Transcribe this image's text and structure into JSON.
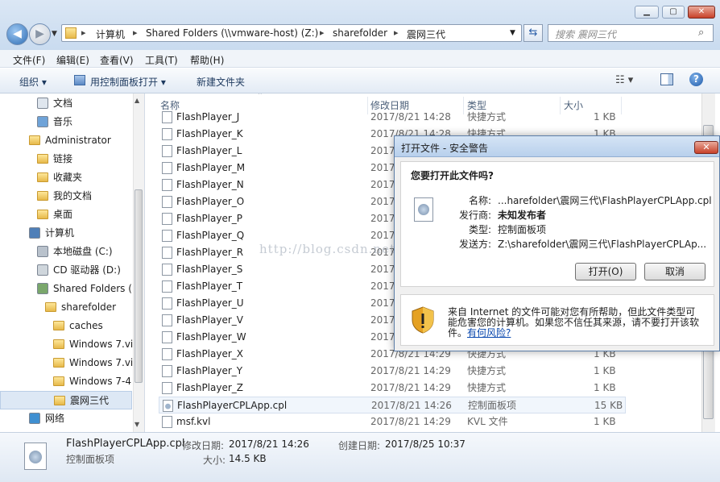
{
  "window": {
    "minimize": "▁",
    "maximize": "▢",
    "close": "✕"
  },
  "address": {
    "crumbs": [
      "计算机",
      "Shared Folders (\\\\vmware-host) (Z:)",
      "sharefolder",
      "震网三代"
    ],
    "search_placeholder": "搜索 震网三代"
  },
  "menubar": [
    "文件(F)",
    "编辑(E)",
    "查看(V)",
    "工具(T)",
    "帮助(H)"
  ],
  "toolbar": {
    "organize": "组织 ▾",
    "open_cpl": "用控制面板打开 ▾",
    "new_folder": "新建文件夹"
  },
  "sidebar": {
    "items": [
      {
        "label": "文档",
        "icon": "document-library-icon"
      },
      {
        "label": "音乐",
        "icon": "music-icon"
      },
      {
        "label": "Administrator",
        "icon": "user-folder-icon"
      },
      {
        "label": "链接",
        "icon": "folder-icon"
      },
      {
        "label": "收藏夹",
        "icon": "folder-icon"
      },
      {
        "label": "我的文档",
        "icon": "folder-icon"
      },
      {
        "label": "桌面",
        "icon": "folder-icon"
      },
      {
        "label": "计算机",
        "icon": "computer-icon"
      },
      {
        "label": "本地磁盘 (C:)",
        "icon": "drive-icon"
      },
      {
        "label": "CD 驱动器 (D:)",
        "icon": "cd-icon"
      },
      {
        "label": "Shared Folders (",
        "icon": "network-drive-icon"
      },
      {
        "label": "sharefolder",
        "icon": "folder-icon"
      },
      {
        "label": "caches",
        "icon": "folder-icon"
      },
      {
        "label": "Windows 7.vi",
        "icon": "folder-icon"
      },
      {
        "label": "Windows 7.vi",
        "icon": "folder-icon"
      },
      {
        "label": "Windows 7-4",
        "icon": "folder-icon"
      },
      {
        "label": "震网三代",
        "icon": "folder-icon"
      },
      {
        "label": "网络",
        "icon": "network-icon"
      }
    ]
  },
  "columns": {
    "name": "名称",
    "modified": "修改日期",
    "type": "类型",
    "size": "大小"
  },
  "files": [
    {
      "name": "FlashPlayer_J",
      "date": "2017/8/21 14:28",
      "type": "快捷方式",
      "size": "1 KB"
    },
    {
      "name": "FlashPlayer_K",
      "date": "2017/8/21 14:28",
      "type": "快捷方式",
      "size": "1 KB"
    },
    {
      "name": "FlashPlayer_L",
      "date": "2017",
      "type": "",
      "size": ""
    },
    {
      "name": "FlashPlayer_M",
      "date": "2017",
      "type": "",
      "size": ""
    },
    {
      "name": "FlashPlayer_N",
      "date": "2017",
      "type": "",
      "size": ""
    },
    {
      "name": "FlashPlayer_O",
      "date": "2017",
      "type": "",
      "size": ""
    },
    {
      "name": "FlashPlayer_P",
      "date": "2017",
      "type": "",
      "size": ""
    },
    {
      "name": "FlashPlayer_Q",
      "date": "2017",
      "type": "",
      "size": ""
    },
    {
      "name": "FlashPlayer_R",
      "date": "2017",
      "type": "",
      "size": ""
    },
    {
      "name": "FlashPlayer_S",
      "date": "2017",
      "type": "",
      "size": ""
    },
    {
      "name": "FlashPlayer_T",
      "date": "2017",
      "type": "",
      "size": ""
    },
    {
      "name": "FlashPlayer_U",
      "date": "2017",
      "type": "",
      "size": ""
    },
    {
      "name": "FlashPlayer_V",
      "date": "2017",
      "type": "",
      "size": ""
    },
    {
      "name": "FlashPlayer_W",
      "date": "2017",
      "type": "",
      "size": ""
    },
    {
      "name": "FlashPlayer_X",
      "date": "2017/8/21 14:29",
      "type": "快捷方式",
      "size": "1 KB"
    },
    {
      "name": "FlashPlayer_Y",
      "date": "2017/8/21 14:29",
      "type": "快捷方式",
      "size": "1 KB"
    },
    {
      "name": "FlashPlayer_Z",
      "date": "2017/8/21 14:29",
      "type": "快捷方式",
      "size": "1 KB"
    },
    {
      "name": "FlashPlayerCPLApp.cpl",
      "date": "2017/8/21 14:26",
      "type": "控制面板项",
      "size": "15 KB"
    },
    {
      "name": "msf.kvl",
      "date": "2017/8/21 14:29",
      "type": "KVL 文件",
      "size": "1 KB"
    }
  ],
  "details": {
    "filename": "FlashPlayerCPLApp.cpl",
    "filetype": "控制面板项",
    "modified_label": "修改日期:",
    "modified_value": "2017/8/21 14:26",
    "created_label": "创建日期:",
    "created_value": "2017/8/25 10:37",
    "size_label": "大小:",
    "size_value": "14.5 KB"
  },
  "dialog": {
    "title": "打开文件 - 安全警告",
    "question": "您要打开此文件吗?",
    "name_label": "名称:",
    "name_value": "...harefolder\\震网三代\\FlashPlayerCPLApp.cpl",
    "publisher_label": "发行商:",
    "publisher_value": "未知发布者",
    "type_label": "类型:",
    "type_value": "控制面板项",
    "from_label": "发送方:",
    "from_value": "Z:\\sharefolder\\震网三代\\FlashPlayerCPLAp...",
    "open_button": "打开(O)",
    "cancel_button": "取消",
    "warning_line1": "来自 Internet 的文件可能对您有所帮助，但此文件类型可",
    "warning_line2": "能危害您的计算机。如果您不信任其来源，请不要打开该软",
    "warning_line3": "件。",
    "risk_link": "有何风险?"
  },
  "watermark": "http://blog.csdn.net/GUINEW"
}
